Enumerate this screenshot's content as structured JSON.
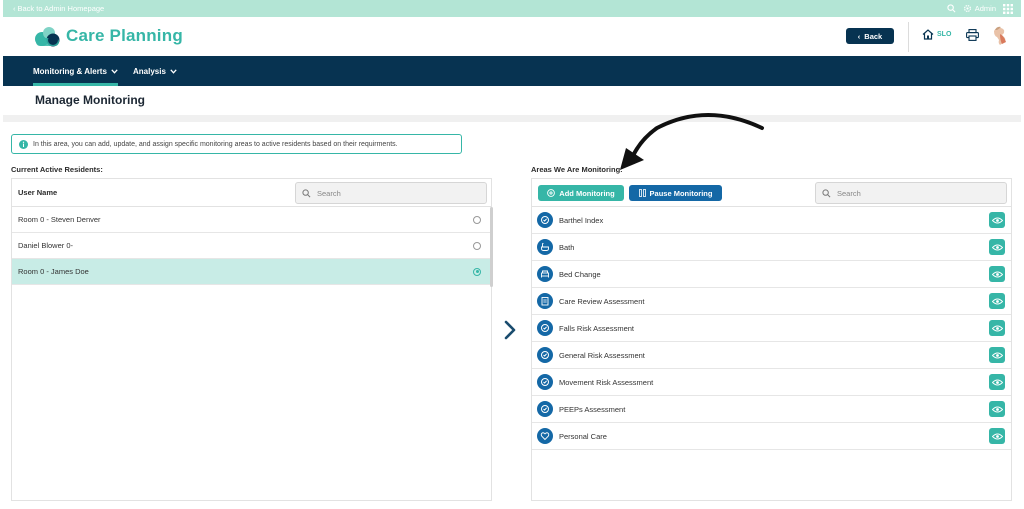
{
  "topbar": {
    "back_link": "Back to Admin Homepage",
    "admin_label": "Admin"
  },
  "header": {
    "app_title": "Care Planning",
    "back_button": "Back",
    "home_label": "SLO"
  },
  "nav": {
    "items": [
      {
        "label": "Monitoring & Alerts",
        "active": true
      },
      {
        "label": "Analysis",
        "active": false
      }
    ]
  },
  "page": {
    "title": "Manage Monitoring",
    "info_text": "In this area, you can add, update, and assign specific monitoring areas to active residents based on their requirments."
  },
  "residents": {
    "section_label": "Current Active Residents:",
    "column_header": "User Name",
    "search_placeholder": "Search",
    "rows": [
      {
        "name": "Room 0 - Steven Denver",
        "selected": false
      },
      {
        "name": "Daniel Blower 0-",
        "selected": false
      },
      {
        "name": "Room 0 - James Doe",
        "selected": true
      }
    ]
  },
  "monitoring": {
    "section_label": "Areas We Are Monitoring:",
    "add_button": "Add Monitoring",
    "pause_button": "Pause Monitoring",
    "search_placeholder": "Search",
    "areas": [
      {
        "label": "Barthel Index",
        "icon": "assessment-icon"
      },
      {
        "label": "Bath",
        "icon": "bath-icon"
      },
      {
        "label": "Bed Change",
        "icon": "bed-icon"
      },
      {
        "label": "Care Review Assessment",
        "icon": "clipboard-icon"
      },
      {
        "label": "Falls Risk Assessment",
        "icon": "assessment-icon"
      },
      {
        "label": "General Risk Assessment",
        "icon": "assessment-icon"
      },
      {
        "label": "Movement Risk Assessment",
        "icon": "assessment-icon"
      },
      {
        "label": "PEEPs Assessment",
        "icon": "assessment-icon"
      },
      {
        "label": "Personal Care",
        "icon": "heart-icon"
      }
    ]
  },
  "colors": {
    "teal": "#36b6a7",
    "navy": "#073351",
    "blue": "#1468a6",
    "mint": "#b3e5d5",
    "selected_row": "#c8ece6"
  }
}
